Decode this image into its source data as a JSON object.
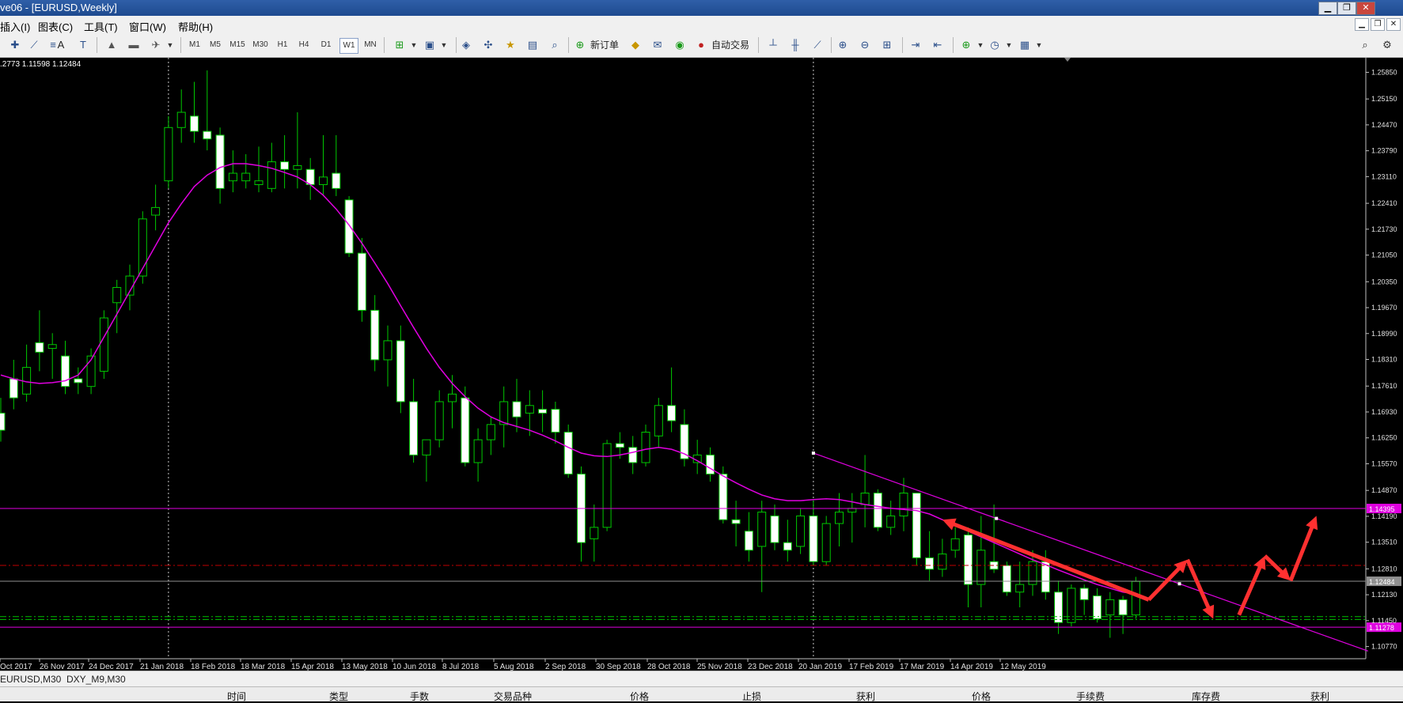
{
  "window": {
    "title": "ve06 - [EURUSD,Weekly]",
    "controls": [
      "▁",
      "❐",
      "✕"
    ]
  },
  "menu": {
    "items": [
      "插入(I)",
      "图表(C)",
      "工具(T)",
      "窗口(W)",
      "帮助(H)"
    ]
  },
  "toolbar": {
    "timeframes": [
      "M1",
      "M5",
      "M15",
      "M30",
      "H1",
      "H4",
      "D1",
      "W1",
      "MN"
    ],
    "active_timeframe": "W1",
    "new_order_label": "新订单",
    "auto_trade_label": "自动交易"
  },
  "chart": {
    "ohlc_readout": ".2773 1.11598 1.12484",
    "colors": {
      "background": "#000000",
      "candle": "#00c800",
      "candle_body_up": "#000000",
      "candle_body_down": "#ffffff",
      "ma": "#e000e0",
      "trendline": "#e000e0",
      "arrow": "#ff3030",
      "resistance": "#e000e0",
      "red_dash": "#c00000",
      "green_dash": "#00c000"
    }
  },
  "chart_data": {
    "type": "candlestick",
    "title": "",
    "symbol": "EURUSD",
    "timeframe": "Weekly",
    "y_ticks": [
      "1.25850",
      "1.25150",
      "1.24470",
      "1.23790",
      "1.23110",
      "1.22410",
      "1.21730",
      "1.21050",
      "1.20350",
      "1.19670",
      "1.18990",
      "1.18310",
      "1.17610",
      "1.16930",
      "1.16250",
      "1.15570",
      "1.14870",
      "1.14190",
      "1.13510",
      "1.12810",
      "1.12130",
      "1.11450",
      "1.10770"
    ],
    "ylim": [
      1.1045,
      1.2615
    ],
    "x_ticks": [
      "Oct 2017",
      "26 Nov 2017",
      "24 Dec 2017",
      "21 Jan 2018",
      "18 Feb 2018",
      "18 Mar 2018",
      "15 Apr 2018",
      "13 May 2018",
      "10 Jun 2018",
      "8 Jul 2018",
      "5 Aug 2018",
      "2 Sep 2018",
      "30 Sep 2018",
      "28 Oct 2018",
      "25 Nov 2018",
      "23 Dec 2018",
      "20 Jan 2019",
      "17 Feb 2019",
      "17 Mar 2019",
      "14 Apr 2019",
      "12 May 2019"
    ],
    "candles": [
      [
        1.169,
        1.173,
        1.1615,
        1.1645
      ],
      [
        1.178,
        1.183,
        1.17,
        1.173
      ],
      [
        1.174,
        1.187,
        1.172,
        1.181
      ],
      [
        1.1875,
        1.196,
        1.18,
        1.185
      ],
      [
        1.186,
        1.19,
        1.178,
        1.187
      ],
      [
        1.184,
        1.188,
        1.174,
        1.176
      ],
      [
        1.178,
        1.181,
        1.174,
        1.177
      ],
      [
        1.176,
        1.186,
        1.174,
        1.184
      ],
      [
        1.18,
        1.196,
        1.178,
        1.194
      ],
      [
        1.198,
        1.204,
        1.19,
        1.202
      ],
      [
        1.2,
        1.208,
        1.196,
        1.205
      ],
      [
        1.205,
        1.222,
        1.203,
        1.22
      ],
      [
        1.221,
        1.229,
        1.217,
        1.223
      ],
      [
        1.23,
        1.247,
        1.228,
        1.244
      ],
      [
        1.244,
        1.254,
        1.24,
        1.248
      ],
      [
        1.247,
        1.256,
        1.24,
        1.243
      ],
      [
        1.243,
        1.259,
        1.238,
        1.241
      ],
      [
        1.242,
        1.244,
        1.224,
        1.228
      ],
      [
        1.23,
        1.238,
        1.227,
        1.232
      ],
      [
        1.23,
        1.237,
        1.228,
        1.232
      ],
      [
        1.229,
        1.239,
        1.227,
        1.23
      ],
      [
        1.228,
        1.24,
        1.227,
        1.235
      ],
      [
        1.235,
        1.242,
        1.228,
        1.233
      ],
      [
        1.233,
        1.248,
        1.228,
        1.234
      ],
      [
        1.233,
        1.236,
        1.225,
        1.229
      ],
      [
        1.229,
        1.242,
        1.226,
        1.231
      ],
      [
        1.232,
        1.242,
        1.226,
        1.228
      ],
      [
        1.225,
        1.226,
        1.21,
        1.211
      ],
      [
        1.211,
        1.215,
        1.193,
        1.196
      ],
      [
        1.196,
        1.2,
        1.18,
        1.183
      ],
      [
        1.183,
        1.192,
        1.176,
        1.188
      ],
      [
        1.188,
        1.192,
        1.169,
        1.172
      ],
      [
        1.172,
        1.178,
        1.156,
        1.158
      ],
      [
        1.158,
        1.161,
        1.151,
        1.162
      ],
      [
        1.162,
        1.175,
        1.16,
        1.172
      ],
      [
        1.172,
        1.179,
        1.165,
        1.174
      ],
      [
        1.173,
        1.176,
        1.155,
        1.156
      ],
      [
        1.156,
        1.165,
        1.151,
        1.162
      ],
      [
        1.162,
        1.168,
        1.158,
        1.166
      ],
      [
        1.166,
        1.176,
        1.16,
        1.172
      ],
      [
        1.172,
        1.178,
        1.164,
        1.168
      ],
      [
        1.169,
        1.175,
        1.163,
        1.171
      ],
      [
        1.17,
        1.175,
        1.164,
        1.169
      ],
      [
        1.17,
        1.172,
        1.161,
        1.164
      ],
      [
        1.164,
        1.166,
        1.152,
        1.153
      ],
      [
        1.153,
        1.155,
        1.13,
        1.135
      ],
      [
        1.136,
        1.145,
        1.13,
        1.139
      ],
      [
        1.139,
        1.162,
        1.138,
        1.161
      ],
      [
        1.161,
        1.164,
        1.157,
        1.16
      ],
      [
        1.16,
        1.163,
        1.153,
        1.156
      ],
      [
        1.156,
        1.166,
        1.155,
        1.164
      ],
      [
        1.163,
        1.173,
        1.16,
        1.171
      ],
      [
        1.171,
        1.181,
        1.164,
        1.167
      ],
      [
        1.166,
        1.17,
        1.155,
        1.157
      ],
      [
        1.156,
        1.162,
        1.153,
        1.158
      ],
      [
        1.158,
        1.16,
        1.151,
        1.153
      ],
      [
        1.153,
        1.155,
        1.14,
        1.141
      ],
      [
        1.141,
        1.146,
        1.134,
        1.14
      ],
      [
        1.138,
        1.143,
        1.13,
        1.133
      ],
      [
        1.134,
        1.146,
        1.122,
        1.143
      ],
      [
        1.142,
        1.145,
        1.133,
        1.135
      ],
      [
        1.135,
        1.141,
        1.13,
        1.133
      ],
      [
        1.134,
        1.144,
        1.132,
        1.142
      ],
      [
        1.142,
        1.146,
        1.129,
        1.13
      ],
      [
        1.13,
        1.142,
        1.129,
        1.14
      ],
      [
        1.14,
        1.148,
        1.134,
        1.143
      ],
      [
        1.143,
        1.148,
        1.135,
        1.144
      ],
      [
        1.145,
        1.158,
        1.139,
        1.148
      ],
      [
        1.148,
        1.149,
        1.138,
        1.139
      ],
      [
        1.139,
        1.146,
        1.137,
        1.142
      ],
      [
        1.142,
        1.152,
        1.138,
        1.148
      ],
      [
        1.148,
        1.148,
        1.129,
        1.131
      ],
      [
        1.131,
        1.138,
        1.125,
        1.128
      ],
      [
        1.128,
        1.136,
        1.126,
        1.132
      ],
      [
        1.133,
        1.139,
        1.131,
        1.136
      ],
      [
        1.137,
        1.139,
        1.118,
        1.124
      ],
      [
        1.124,
        1.142,
        1.118,
        1.133
      ],
      [
        1.13,
        1.145,
        1.127,
        1.128
      ],
      [
        1.129,
        1.13,
        1.121,
        1.122
      ],
      [
        1.122,
        1.13,
        1.118,
        1.124
      ],
      [
        1.124,
        1.133,
        1.121,
        1.13
      ],
      [
        1.13,
        1.133,
        1.12,
        1.122
      ],
      [
        1.122,
        1.125,
        1.111,
        1.114
      ],
      [
        1.114,
        1.124,
        1.113,
        1.123
      ],
      [
        1.123,
        1.124,
        1.116,
        1.12
      ],
      [
        1.121,
        1.123,
        1.114,
        1.115
      ],
      [
        1.116,
        1.122,
        1.11,
        1.12
      ],
      [
        1.12,
        1.121,
        1.111,
        1.116
      ],
      [
        1.116,
        1.126,
        1.115,
        1.1248
      ]
    ],
    "ma": [
      1.179,
      1.178,
      1.1772,
      1.1768,
      1.177,
      1.1775,
      1.179,
      1.183,
      1.189,
      1.195,
      1.201,
      1.207,
      1.213,
      1.219,
      1.224,
      1.2285,
      1.2315,
      1.2335,
      1.2345,
      1.2345,
      1.234,
      1.2333,
      1.2322,
      1.231,
      1.229,
      1.2262,
      1.2226,
      1.2184,
      1.2136,
      1.2084,
      1.203,
      1.1972,
      1.1915,
      1.186,
      1.181,
      1.1768,
      1.1733,
      1.1703,
      1.168,
      1.1665,
      1.1655,
      1.1645,
      1.1632,
      1.1617,
      1.16,
      1.1585,
      1.1578,
      1.1576,
      1.158,
      1.1587,
      1.1595,
      1.16,
      1.1595,
      1.1583,
      1.1565,
      1.1545,
      1.1525,
      1.1507,
      1.149,
      1.1475,
      1.1465,
      1.146,
      1.146,
      1.1463,
      1.1465,
      1.1463,
      1.1457,
      1.145,
      1.1445,
      1.144,
      1.1437,
      1.1434,
      1.1425,
      1.141,
      1.1395,
      1.138,
      1.1365,
      1.135,
      1.1335,
      1.132,
      1.1305,
      1.1292,
      1.1278,
      1.1265,
      1.1252,
      1.124,
      1.123,
      1.122,
      1.1215
    ],
    "horizontal_lines": [
      {
        "price": 1.14395,
        "label": "1.14395",
        "style": "solid",
        "color": "#e000e0"
      },
      {
        "price": 1.129,
        "style": "dashdot",
        "color": "#c00000"
      },
      {
        "price": 1.12484,
        "label": "1.12484",
        "style": "solid",
        "color": "#909090"
      },
      {
        "price": 1.11555,
        "style": "dashdot",
        "color": "#00c000"
      },
      {
        "price": 1.1148,
        "style": "dashdot",
        "color": "#00c000"
      },
      {
        "price": 1.11278,
        "label": "1.11278",
        "style": "solid",
        "color": "#e000e0"
      }
    ],
    "vertical_lines": [
      {
        "candle_index": 13
      },
      {
        "candle_index": 63
      }
    ],
    "trendline": {
      "start": [
        63,
        1.1585
      ],
      "end": [
        106,
        1.1065
      ]
    },
    "annotations": [
      {
        "type": "arrow",
        "points": [
          [
            89,
            1.12
          ],
          [
            73,
            1.141
          ]
        ]
      },
      {
        "type": "arrow",
        "points": [
          [
            89,
            1.12
          ],
          [
            92,
            1.1305
          ]
        ]
      },
      {
        "type": "arrow",
        "points": [
          [
            92,
            1.1305
          ],
          [
            94,
            1.115
          ]
        ]
      },
      {
        "type": "arrow",
        "points": [
          [
            96,
            1.116
          ],
          [
            98,
            1.1315
          ]
        ]
      },
      {
        "type": "arrow",
        "points": [
          [
            98,
            1.1315
          ],
          [
            100,
            1.125
          ]
        ]
      },
      {
        "type": "arrow",
        "points": [
          [
            100,
            1.125
          ],
          [
            102,
            1.142
          ]
        ]
      }
    ]
  },
  "tabs": {
    "items": [
      "EURUSD,M30",
      "DXY_M9,M30"
    ]
  },
  "terminal": {
    "columns": [
      "时间",
      "类型",
      "手数",
      "交易品种",
      "价格",
      "止损",
      "获利",
      "价格",
      "手续费",
      "库存费",
      "获利"
    ]
  }
}
